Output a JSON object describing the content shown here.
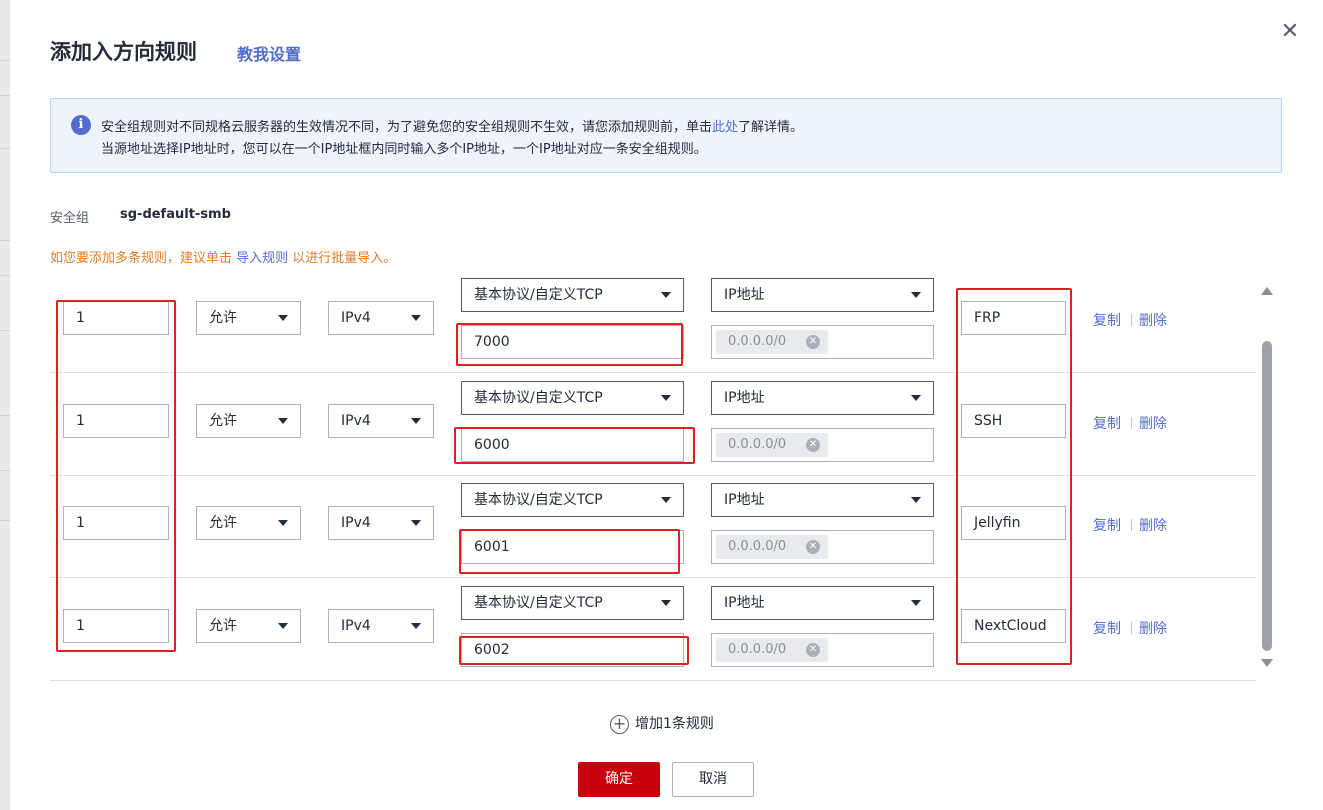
{
  "dialog": {
    "title": "添加入方向规则",
    "guide_link": "教我设置",
    "close_glyph": "✕"
  },
  "notice": {
    "icon": "info-icon",
    "line1_before": "安全组规则对不同规格云服务器的生效情况不同，为了避免您的安全组规则不生效，请您添加规则前，单击",
    "line1_link": "此处",
    "line1_after": "了解详情。",
    "line2": "当源地址选择IP地址时，您可以在一个IP地址框内同时输入多个IP地址，一个IP地址对应一条安全组规则。"
  },
  "security_group": {
    "label": "安全组",
    "value": "sg-default-smb"
  },
  "hint": {
    "before": "如您要添加多条规则，建议单击 ",
    "link": "导入规则",
    "after": " 以进行批量导入。"
  },
  "rules": [
    {
      "priority": "1",
      "policy": "允许",
      "type": "IPv4",
      "protocol": "基本协议/自定义TCP",
      "port": "7000",
      "source_type": "IP地址",
      "source_ip": "0.0.0.0/0",
      "description": "FRP",
      "copy": "复制",
      "delete": "删除"
    },
    {
      "priority": "1",
      "policy": "允许",
      "type": "IPv4",
      "protocol": "基本协议/自定义TCP",
      "port": "6000",
      "source_type": "IP地址",
      "source_ip": "0.0.0.0/0",
      "description": "SSH",
      "copy": "复制",
      "delete": "删除"
    },
    {
      "priority": "1",
      "policy": "允许",
      "type": "IPv4",
      "protocol": "基本协议/自定义TCP",
      "port": "6001",
      "source_type": "IP地址",
      "source_ip": "0.0.0.0/0",
      "description": "Jellyfin",
      "copy": "复制",
      "delete": "删除"
    },
    {
      "priority": "1",
      "policy": "允许",
      "type": "IPv4",
      "protocol": "基本协议/自定义TCP",
      "port": "6002",
      "source_type": "IP地址",
      "source_ip": "0.0.0.0/0",
      "description": "NextCloud",
      "copy": "复制",
      "delete": "删除"
    }
  ],
  "add_rule": "增加1条规则",
  "buttons": {
    "confirm": "确定",
    "cancel": "取消"
  },
  "colors": {
    "primary": "#c7000b",
    "link": "#526ecc",
    "hint": "#e37d29",
    "annotation": "#e02020"
  }
}
